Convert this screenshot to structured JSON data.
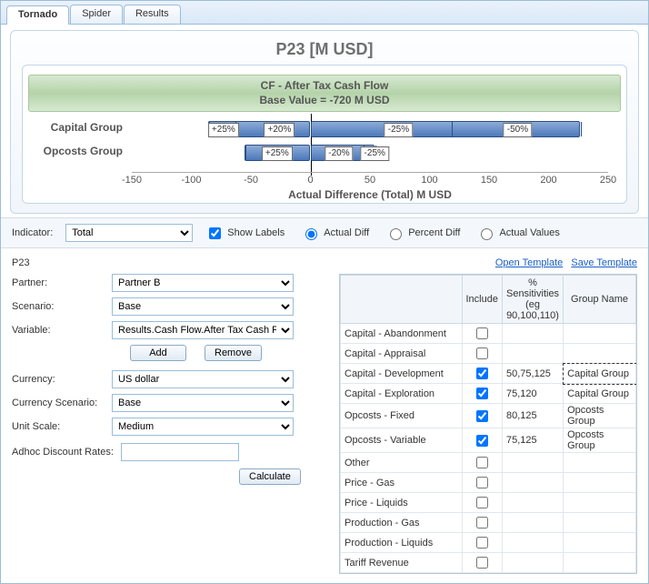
{
  "tabs": [
    "Tornado",
    "Spider",
    "Results"
  ],
  "active_tab": 0,
  "chart_title": "P23 [M USD]",
  "banner_line1": "CF - After Tax Cash Flow",
  "banner_line2": "Base Value = -720 M USD",
  "x_axis_label": "Actual Difference (Total) M USD",
  "chart_data": {
    "type": "tornado",
    "xlabel": "Actual Difference (Total) M USD",
    "xlim": [
      -150,
      250
    ],
    "ticks": [
      -150,
      -100,
      -50,
      0,
      50,
      100,
      150,
      200,
      250
    ],
    "rows": [
      {
        "label": "Capital Group",
        "left_extent": -86,
        "right_extent": 226,
        "left_labels": [
          {
            "pos": -73,
            "text": "+25%"
          },
          {
            "pos": -26,
            "text": "+20%"
          }
        ],
        "right_labels": [
          {
            "pos": 74,
            "text": "-25%"
          },
          {
            "pos": 174,
            "text": "-50%"
          }
        ],
        "ticks_left": [
          -64,
          -86
        ],
        "ticks_right": [
          118,
          226
        ]
      },
      {
        "label": "Opcosts Group",
        "left_extent": -55,
        "right_extent": 54,
        "left_labels": [
          {
            "pos": -28,
            "text": "+25%"
          }
        ],
        "right_labels": [
          {
            "pos": 24,
            "text": "-20%"
          },
          {
            "pos": 54,
            "text": "-25%"
          }
        ],
        "ticks_left": [
          -55
        ],
        "ticks_right": [
          44,
          54
        ]
      }
    ]
  },
  "indicator": {
    "label": "Indicator:",
    "value": "Total",
    "show_labels_label": "Show Labels",
    "show_labels": true,
    "diff_mode": "actual",
    "radio_actual": "Actual Diff",
    "radio_percent": "Percent Diff",
    "radio_values": "Actual Values"
  },
  "section_title": "P23",
  "link_open": "Open Template",
  "link_save": "Save Template",
  "form": {
    "partner_label": "Partner:",
    "partner_value": "Partner B",
    "scenario_label": "Scenario:",
    "scenario_value": "Base",
    "variable_label": "Variable:",
    "variable_value": "Results.Cash Flow.After Tax Cash Flow",
    "add_btn": "Add",
    "remove_btn": "Remove",
    "currency_label": "Currency:",
    "currency_value": "US dollar",
    "curr_scen_label": "Currency Scenario:",
    "curr_scen_value": "Base",
    "unit_label": "Unit Scale:",
    "unit_value": "Medium",
    "adhoc_label": "Adhoc Discount Rates:",
    "adhoc_value": "",
    "calc_btn": "Calculate"
  },
  "grid": {
    "col_include": "Include",
    "col_sens": "% Sensitivities (eg 90,100,110)",
    "col_group": "Group Name",
    "rows": [
      {
        "name": "Capital - Abandonment",
        "include": false,
        "sens": "",
        "group": ""
      },
      {
        "name": "Capital - Appraisal",
        "include": false,
        "sens": "",
        "group": ""
      },
      {
        "name": "Capital - Development",
        "include": true,
        "sens": "50,75,125",
        "group": "Capital Group",
        "sel": true
      },
      {
        "name": "Capital - Exploration",
        "include": true,
        "sens": "75,120",
        "group": "Capital Group"
      },
      {
        "name": "Opcosts - Fixed",
        "include": true,
        "sens": "80,125",
        "group": "Opcosts Group"
      },
      {
        "name": "Opcosts - Variable",
        "include": true,
        "sens": "75,125",
        "group": "Opcosts Group"
      },
      {
        "name": "Other",
        "include": false,
        "sens": "",
        "group": ""
      },
      {
        "name": "Price - Gas",
        "include": false,
        "sens": "",
        "group": ""
      },
      {
        "name": "Price - Liquids",
        "include": false,
        "sens": "",
        "group": ""
      },
      {
        "name": "Production - Gas",
        "include": false,
        "sens": "",
        "group": ""
      },
      {
        "name": "Production - Liquids",
        "include": false,
        "sens": "",
        "group": ""
      },
      {
        "name": "Tariff Revenue",
        "include": false,
        "sens": "",
        "group": ""
      }
    ]
  }
}
